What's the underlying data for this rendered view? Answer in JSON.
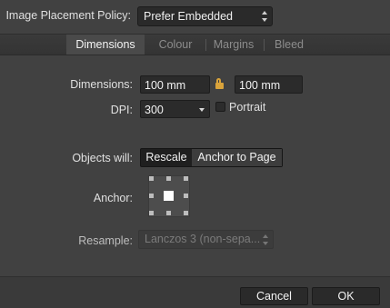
{
  "policy": {
    "label": "Image Placement Policy:",
    "value": "Prefer Embedded"
  },
  "tabs": [
    {
      "label": "Dimensions",
      "active": true
    },
    {
      "label": "Colour",
      "active": false
    },
    {
      "label": "Margins",
      "active": false
    },
    {
      "label": "Bleed",
      "active": false
    }
  ],
  "dimensions": {
    "label": "Dimensions:",
    "width": "100 mm",
    "height": "100 mm",
    "lock_icon": "lock-icon"
  },
  "dpi": {
    "label": "DPI:",
    "value": "300"
  },
  "portrait": {
    "label": "Portrait",
    "checked": false
  },
  "objects": {
    "label": "Objects will:",
    "options": [
      "Rescale",
      "Anchor to Page"
    ],
    "selected": "Anchor to Page"
  },
  "anchor": {
    "label": "Anchor:"
  },
  "resample": {
    "label": "Resample:",
    "value": "Lanczos 3 (non-sepa..."
  },
  "buttons": {
    "cancel": "Cancel",
    "ok": "OK"
  },
  "colors": {
    "background": "#414141",
    "tabbar": "#363636",
    "field": "#2b2b2b",
    "lock": "#d9a33b"
  }
}
